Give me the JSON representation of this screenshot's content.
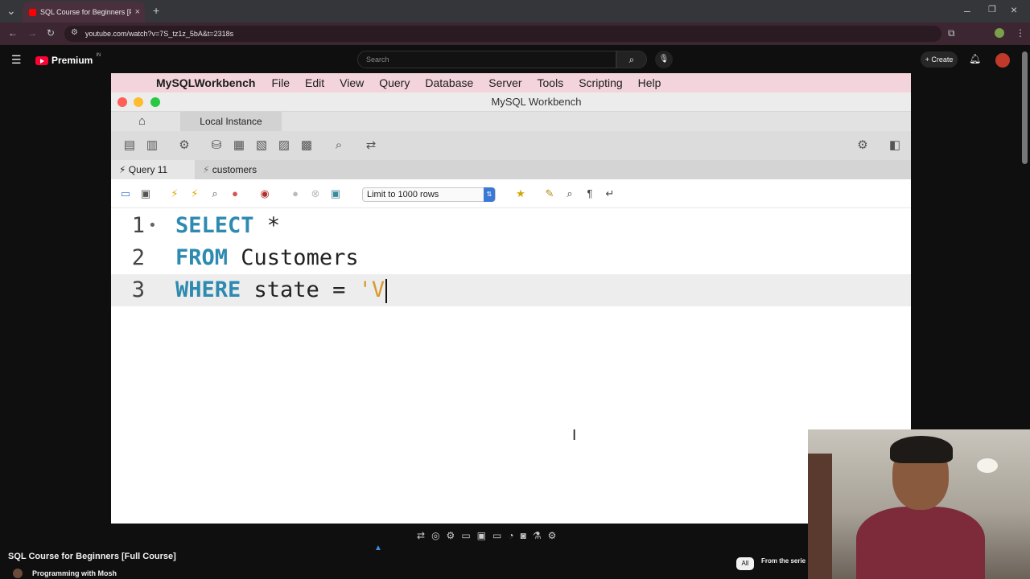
{
  "browser": {
    "tab_title": "SQL Course for Beginners [Full Course]",
    "url": "youtube.com/watch?v=7S_tz1z_5bA&t=2318s"
  },
  "youtube": {
    "logo_text": "Premium",
    "logo_badge": "IN",
    "search_placeholder": "Search",
    "create_label": "+ Create",
    "video_title": "SQL Course for Beginners [Full Course]",
    "channel_name": "Programming with Mosh",
    "chips": [
      "All",
      "From the serie"
    ]
  },
  "workbench": {
    "menu": [
      "MySQLWorkbench",
      "File",
      "Edit",
      "View",
      "Query",
      "Database",
      "Server",
      "Tools",
      "Scripting",
      "Help"
    ],
    "window_title": "MySQL Workbench",
    "instance_tab": "Local Instance",
    "query_tabs": [
      "Query 11",
      "customers"
    ],
    "limit_select": "Limit to 1000 rows",
    "editor": {
      "lines": [
        {
          "num": "1",
          "keyword": "SELECT",
          "rest": " *",
          "string": ""
        },
        {
          "num": "2",
          "keyword": "FROM",
          "rest": " Customers",
          "string": ""
        },
        {
          "num": "3",
          "keyword": "WHERE",
          "rest": " state = ",
          "string": "'V"
        }
      ]
    },
    "colors": {
      "keyword": "#2d8ab0",
      "string": "#d89a2a",
      "menubar": "#f3d4dc"
    }
  }
}
